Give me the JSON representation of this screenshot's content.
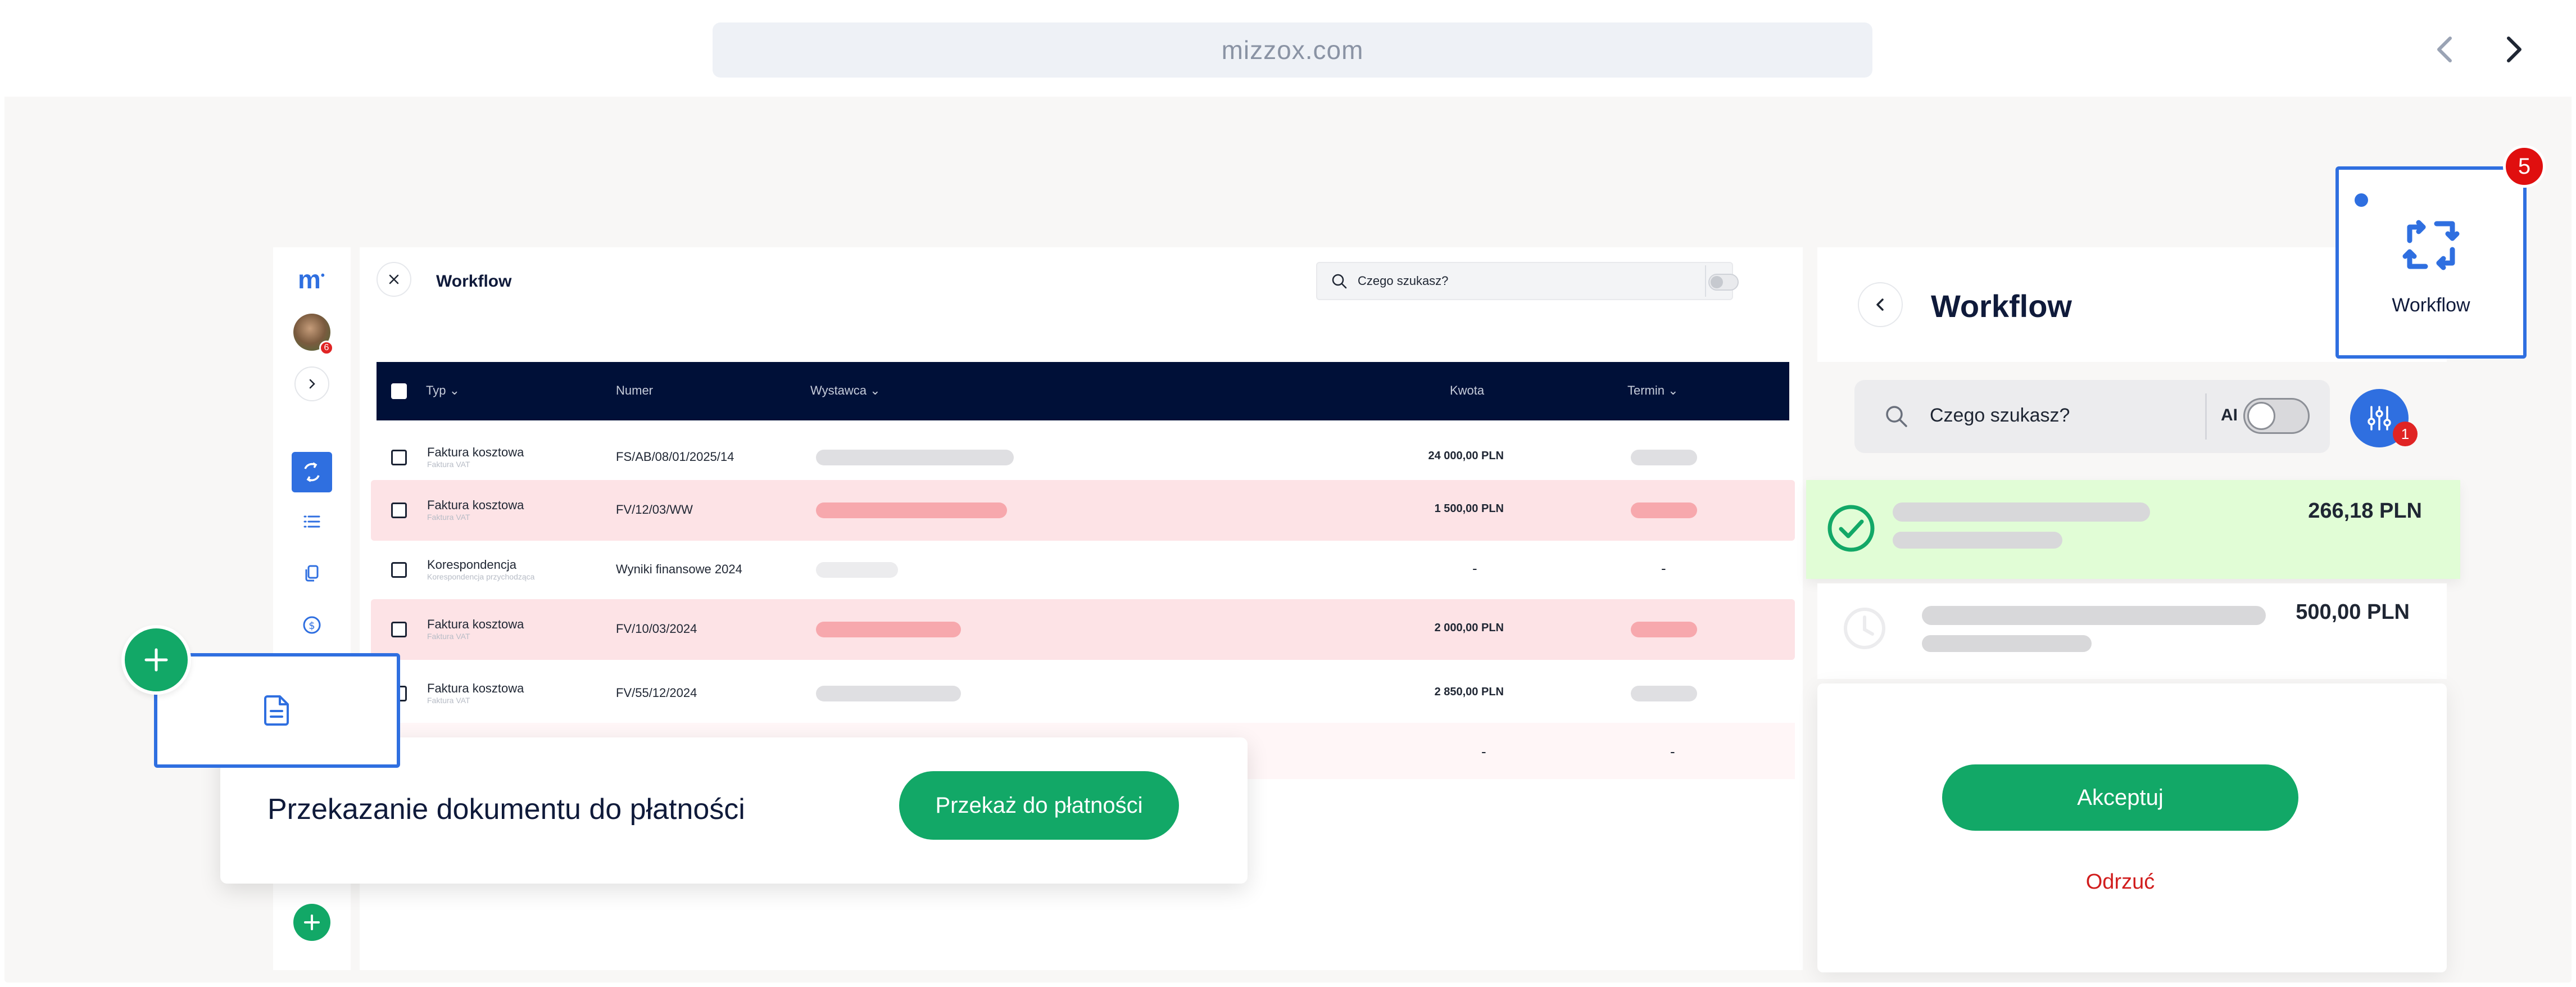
{
  "browser": {
    "url": "mizzox.com"
  },
  "sidebar": {
    "logo": "m",
    "avatar_badge": "6"
  },
  "main": {
    "title": "Workflow",
    "search_placeholder": "Czego szukasz?",
    "ai_label": "AI",
    "columns": [
      "Typ",
      "Numer",
      "Wystawca",
      "Kwota",
      "Termin"
    ],
    "rows": [
      {
        "type": "Faktura kosztowa",
        "subtype": "Faktura VAT",
        "number": "FS/AB/08/01/2025/14",
        "amount": "24 000,00 PLN",
        "highlight": "none"
      },
      {
        "type": "Faktura kosztowa",
        "subtype": "Faktura VAT",
        "number": "FV/12/03/WW",
        "amount": "1 500,00 PLN",
        "highlight": "red"
      },
      {
        "type": "Korespondencja",
        "subtype": "Korespondencja przychodząca",
        "number": "Wyniki finansowe 2024",
        "amount": "-",
        "deadline": "-",
        "highlight": "none"
      },
      {
        "type": "Faktura kosztowa",
        "subtype": "Faktura VAT",
        "number": "FV/10/03/2024",
        "amount": "2 000,00 PLN",
        "highlight": "red"
      },
      {
        "type": "Faktura kosztowa",
        "subtype": "Faktura VAT",
        "number": "FV/55/12/2024",
        "amount": "2 850,00 PLN",
        "highlight": "none"
      },
      {
        "amount": "-",
        "deadline": "-",
        "highlight": "faint"
      }
    ]
  },
  "right_panel": {
    "title": "Workflow",
    "search_placeholder": "Czego szukasz?",
    "ai_label": "AI",
    "filter_badge": "1",
    "payments": [
      {
        "amount": "266,18 PLN",
        "status": "approved"
      },
      {
        "amount": "500,00 PLN",
        "status": "pending"
      }
    ],
    "accept_label": "Akceptuj",
    "reject_label": "Odrzuć"
  },
  "workflow_card": {
    "label": "Workflow",
    "badge": "5"
  },
  "transfer_card": {
    "text": "Przekazanie dokumentu do płatności",
    "button_label": "Przekaż do płatności"
  },
  "colors": {
    "accent_blue": "#2f6fe0",
    "green": "#12a867",
    "navy": "#001038",
    "row_red": "#fde3e6",
    "paid_green": "#e1fdd6",
    "badge_red": "#e02424"
  }
}
